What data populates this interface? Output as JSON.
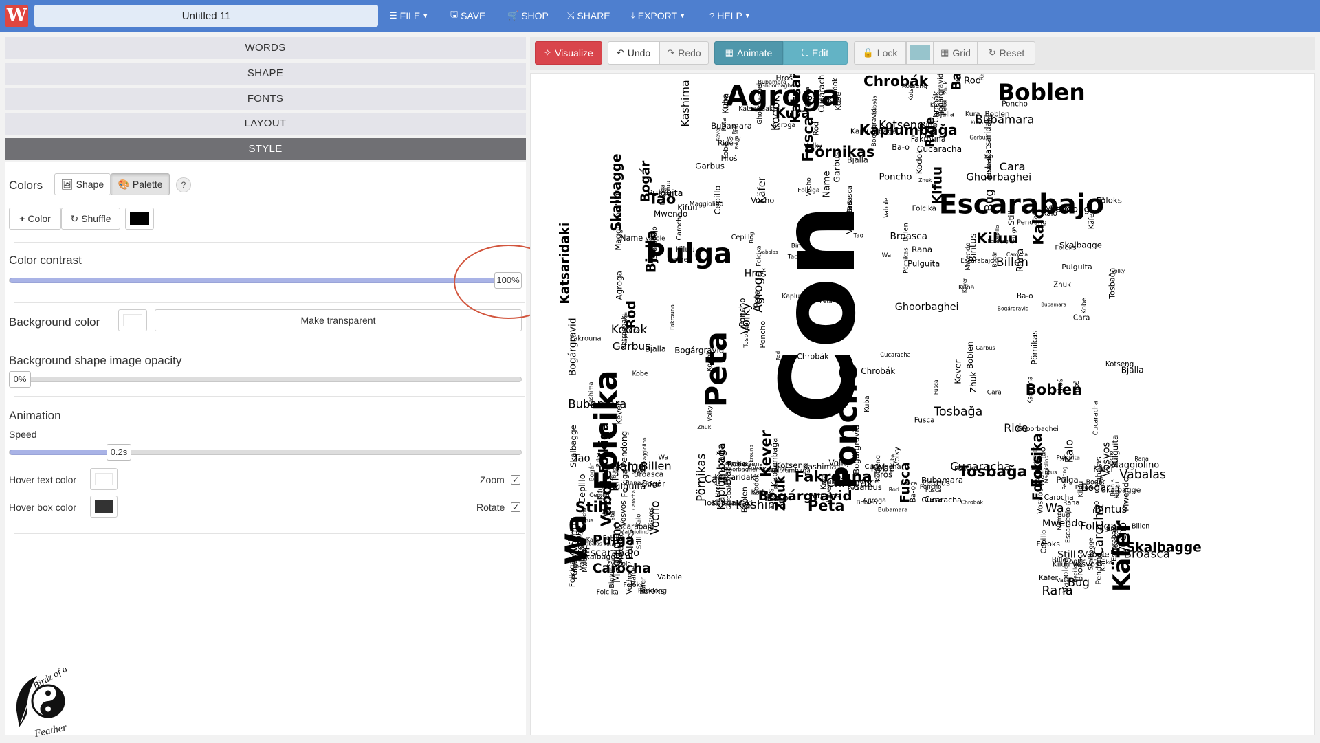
{
  "header": {
    "title": "Untitled 11",
    "menu": [
      {
        "label": "FILE",
        "icon": "menu-icon"
      },
      {
        "label": "SAVE",
        "icon": "save-icon"
      },
      {
        "label": "SHOP",
        "icon": "cart-icon"
      },
      {
        "label": "SHARE",
        "icon": "share-icon"
      },
      {
        "label": "EXPORT",
        "icon": "download-icon"
      },
      {
        "label": "HELP",
        "icon": "question-icon"
      }
    ],
    "logo_letter": "W"
  },
  "sidebar": {
    "sections": [
      "WORDS",
      "SHAPE",
      "FONTS",
      "LAYOUT",
      "STYLE"
    ],
    "active_section": "STYLE",
    "colors": {
      "label": "Colors",
      "shape_btn": "Shape",
      "palette_btn": "Palette",
      "help": "?",
      "add_color_btn": "Color",
      "shuffle_btn": "Shuffle",
      "palette_color": "#000000"
    },
    "contrast": {
      "label": "Color contrast",
      "value_text": "100%",
      "value": 1.0
    },
    "background": {
      "label": "Background color",
      "transparent_btn": "Make transparent",
      "color": "#ffffff"
    },
    "opacity": {
      "label": "Background shape image opacity",
      "value_text": "0%",
      "value": 0.0
    },
    "animation": {
      "label": "Animation",
      "speed_label": "Speed",
      "speed_value": "0.2s",
      "speed_fraction": 0.2,
      "hover_text_label": "Hover text color",
      "hover_text_color": "#ffffff",
      "hover_box_label": "Hover box color",
      "hover_box_color": "#333333",
      "zoom_label": "Zoom",
      "zoom_checked": true,
      "rotate_label": "Rotate",
      "rotate_checked": true
    }
  },
  "toolbar": {
    "visualize": "Visualize",
    "undo": "Undo",
    "redo": "Redo",
    "animate": "Animate",
    "edit": "Edit",
    "lock": "Lock",
    "grid": "Grid",
    "reset": "Reset",
    "swatch_color": "#97c4cc"
  },
  "wordcloud": {
    "words": [
      {
        "t": "Con",
        "big": true
      },
      {
        "t": "Agroga"
      },
      {
        "t": "Pulga"
      },
      {
        "t": "Peta"
      },
      {
        "t": "Folcika"
      },
      {
        "t": "Poncho"
      },
      {
        "t": "Käfer"
      },
      {
        "t": "Boblen"
      },
      {
        "t": "Escarabajo"
      },
      {
        "t": "Fakrouna"
      },
      {
        "t": "Wa"
      },
      {
        "t": "Kaplumbağa"
      },
      {
        "t": "Bogár"
      },
      {
        "t": "Ride"
      },
      {
        "t": "Name"
      },
      {
        "t": "Kever"
      },
      {
        "t": "Vabole"
      },
      {
        "t": "Chrobák"
      },
      {
        "t": "Vosvos"
      },
      {
        "t": "Ghoorbaghei"
      },
      {
        "t": "Kiluu"
      },
      {
        "t": "Volky"
      },
      {
        "t": "Foloks"
      },
      {
        "t": "Cara"
      },
      {
        "t": "Rana"
      },
      {
        "t": "Kotseng"
      },
      {
        "t": "Pendong"
      },
      {
        "t": "Zhuk"
      },
      {
        "t": "Carocha"
      },
      {
        "t": "Kuba"
      },
      {
        "t": "Vabalas"
      },
      {
        "t": "Kodok"
      },
      {
        "t": "Cepillo"
      },
      {
        "t": "Bjalla"
      },
      {
        "t": "Folkiga"
      },
      {
        "t": "Pörnikas"
      },
      {
        "t": "Bug"
      },
      {
        "t": "Kura"
      },
      {
        "t": "Pulguita"
      },
      {
        "t": "Bogárgravid"
      },
      {
        "t": "Maggiolino"
      },
      {
        "t": "Kashima"
      },
      {
        "t": "Skalbagge"
      },
      {
        "t": "Bubamara"
      },
      {
        "t": "Billen"
      },
      {
        "t": "Tosbağa"
      },
      {
        "t": "Vocho"
      },
      {
        "t": "Fusca"
      },
      {
        "t": "Broasca"
      },
      {
        "t": "Garbus"
      },
      {
        "t": "Kifuu"
      },
      {
        "t": "Hroš"
      },
      {
        "t": "Still"
      },
      {
        "t": "Ba-o"
      },
      {
        "t": "Bintus"
      },
      {
        "t": "Katsaridaki"
      },
      {
        "t": "Tao"
      },
      {
        "t": "Kobe"
      },
      {
        "t": "Mwendo"
      },
      {
        "t": "Cucaracha"
      },
      {
        "t": "Kalo"
      },
      {
        "t": "Rod"
      }
    ]
  },
  "brand": {
    "text": "Birdz of a Feather"
  }
}
